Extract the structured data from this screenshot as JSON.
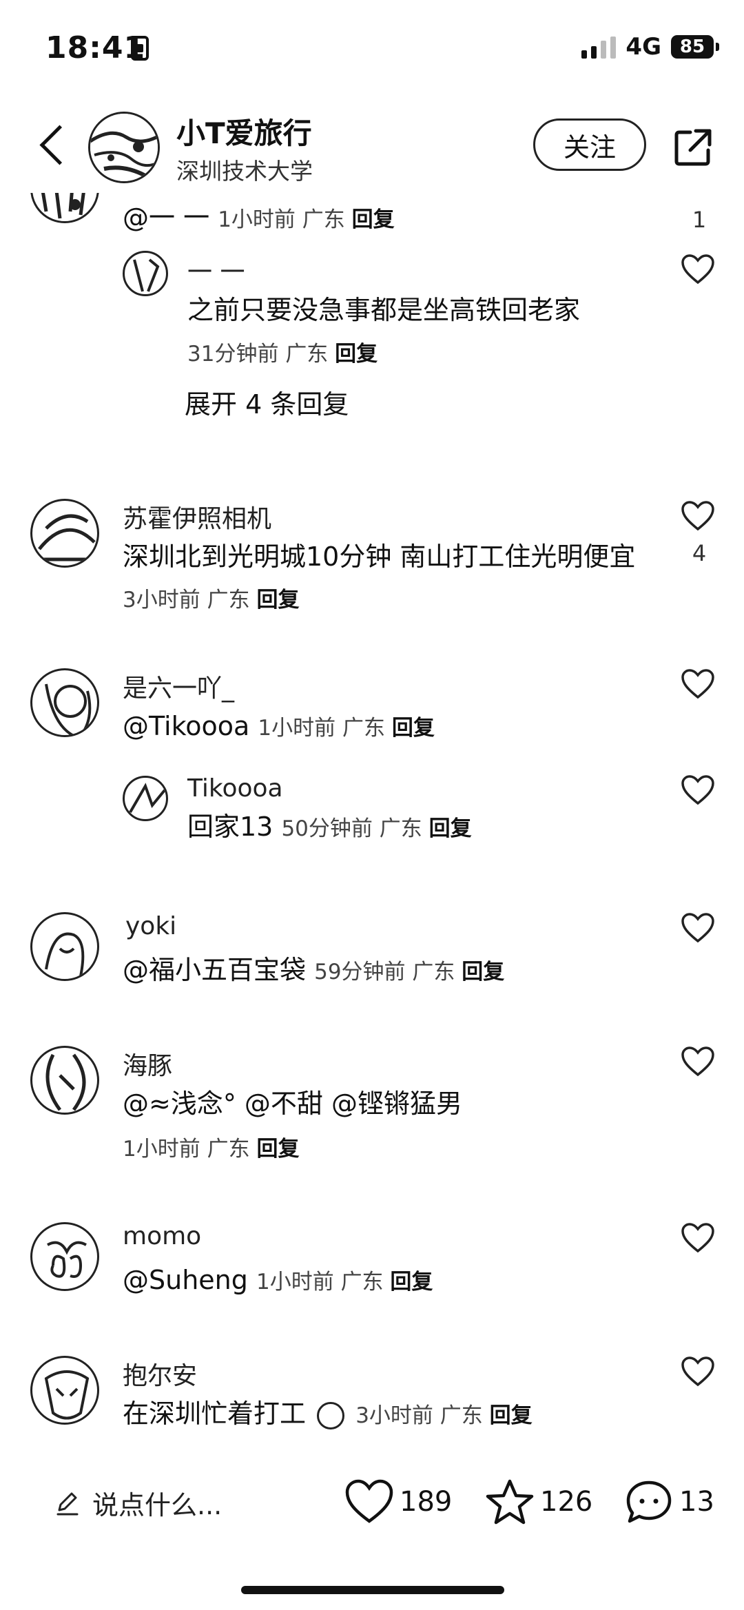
{
  "status": {
    "time": "18:41",
    "network": "4G",
    "battery": "85"
  },
  "header": {
    "title": "小T爱旅行",
    "subtitle": "深圳技术大学",
    "follow_label": "关注"
  },
  "comments": [
    {
      "author": "",
      "text": "@一 一",
      "time": "1小时前",
      "location": "广东",
      "reply": "回复",
      "likes": "1"
    },
    {
      "author": "一 一",
      "text": "之前只要没急事都是坐高铁回老家",
      "time": "31分钟前",
      "location": "广东",
      "reply": "回复",
      "expand": "展开 4 条回复"
    },
    {
      "author": "苏霍伊照相机",
      "text": "深圳北到光明城10分钟 南山打工住光明便宜",
      "time": "3小时前",
      "location": "广东",
      "reply": "回复",
      "likes": "4"
    },
    {
      "author": "是六一吖_",
      "text": "@Tikoooa",
      "time": "1小时前",
      "location": "广东",
      "reply": "回复"
    },
    {
      "author": "Tikoooa",
      "text": "回家13",
      "time": "50分钟前",
      "location": "广东",
      "reply": "回复"
    },
    {
      "author": "yoki",
      "text": "@福小五百宝袋",
      "time": "59分钟前",
      "location": "广东",
      "reply": "回复"
    },
    {
      "author": "海豚",
      "text": "@≈浅念° @不甜 @铿锵猛男",
      "time": "1小时前",
      "location": "广东",
      "reply": "回复"
    },
    {
      "author": "momo",
      "text": "@Suheng",
      "time": "1小时前",
      "location": "广东",
      "reply": "回复"
    },
    {
      "author": "抱尔安",
      "text": "在深圳忙着打工",
      "time": "3小时前",
      "location": "广东",
      "reply": "回复"
    }
  ],
  "bottom": {
    "placeholder": "说点什么...",
    "likes": "189",
    "stars": "126",
    "comments": "13"
  }
}
